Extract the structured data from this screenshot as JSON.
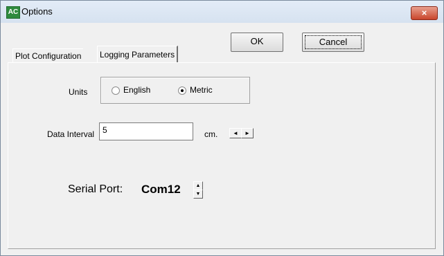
{
  "window": {
    "title": "Options",
    "app_icon_text": "AC",
    "close_glyph": "×"
  },
  "buttons": {
    "ok_label": "OK",
    "cancel_label": "Cancel"
  },
  "tabs": [
    {
      "label": "Plot Configuration",
      "active": false
    },
    {
      "label": "Logging Parameters",
      "active": true
    }
  ],
  "units": {
    "label": "Units",
    "options": [
      {
        "label": "English",
        "selected": false
      },
      {
        "label": "Metric",
        "selected": true
      }
    ]
  },
  "data_interval": {
    "label": "Data Interval",
    "value": "5",
    "unit": "cm.",
    "left_arrow": "◄",
    "right_arrow": "►"
  },
  "serial_port": {
    "label": "Serial Port:",
    "value": "Com12",
    "up_arrow": "▲",
    "down_arrow": "▼"
  },
  "colors": {
    "title_bar": "#dbe6f3",
    "close_button": "#c9452c",
    "app_icon": "#2e8b3e",
    "dialog_background": "#f0f0f0"
  }
}
